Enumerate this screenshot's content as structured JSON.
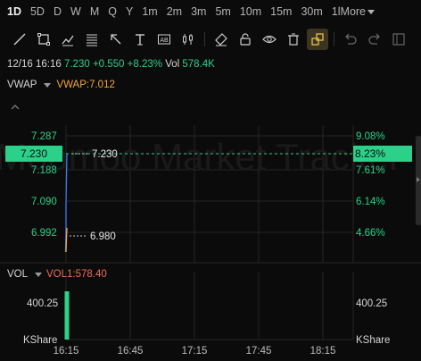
{
  "timeframes": [
    {
      "label": "1D",
      "active": true
    },
    {
      "label": "5D"
    },
    {
      "label": "D"
    },
    {
      "label": "W"
    },
    {
      "label": "M"
    },
    {
      "label": "Q"
    },
    {
      "label": "Y"
    },
    {
      "label": "1m"
    },
    {
      "label": "2m"
    },
    {
      "label": "3m"
    },
    {
      "label": "5m"
    },
    {
      "label": "10m"
    },
    {
      "label": "15m"
    },
    {
      "label": "30m"
    },
    {
      "label": "1l"
    }
  ],
  "more_label": "More",
  "tools": [
    "line-tool-icon",
    "rectangle-tool-icon",
    "trendline-tool-icon",
    "fibonacci-tool-icon",
    "arrow-tool-icon",
    "text-tool-icon",
    "label-tool-icon",
    "candles-tool-icon",
    "eraser-icon",
    "lock-icon",
    "eye-icon",
    "trash-icon",
    "magnet-icon",
    "undo-icon",
    "redo-icon",
    "layout-icon"
  ],
  "info": {
    "datetime": "12/16 16:16",
    "price": "7.230",
    "change": "+0.550",
    "change_pct": "+8.23%",
    "vol_label": "Vol",
    "vol_value": "578.4K"
  },
  "vwap": {
    "name": "VWAP",
    "value_label": "VWAP:7.012"
  },
  "vol_indicator": {
    "name": "VOL",
    "value_label": "VOL1:578.40"
  },
  "watermark": "Moomoo Market Tracker",
  "colors": {
    "green": "#2bd189",
    "orange": "#f2a53a",
    "vol_red": "#f06d5a",
    "line_blue": "#3d7bf0"
  },
  "price_axis": {
    "left_ticks": [
      "7.287",
      "7.188",
      "7.090",
      "6.992"
    ],
    "right_ticks": [
      "9.08%",
      "7.61%",
      "6.14%",
      "4.66%"
    ],
    "current_price": "7.230",
    "current_pct": "8.23%",
    "price_label": "7.230",
    "low_label": "6.980"
  },
  "vol_axis": {
    "left_value": "400.25",
    "right_value": "400.25",
    "left_unit": "KShare",
    "right_unit": "KShare"
  },
  "time_axis": [
    "16:15",
    "16:45",
    "17:15",
    "17:45",
    "18:15"
  ]
}
